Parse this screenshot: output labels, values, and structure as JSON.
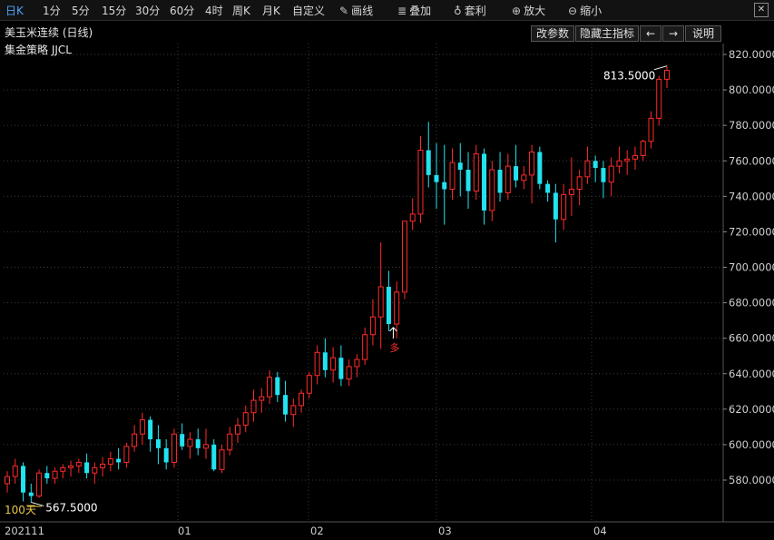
{
  "toolbar": {
    "periods": [
      "日K",
      "1分",
      "5分",
      "15分",
      "30分",
      "60分",
      "4时",
      "周K",
      "月K",
      "自定义"
    ],
    "active_period": "日K",
    "tools": [
      {
        "icon": "pencil-icon",
        "label": "画线"
      },
      {
        "icon": "stack-icon",
        "label": "叠加"
      },
      {
        "icon": "moneybag-icon",
        "label": "套利"
      },
      {
        "icon": "zoom-in-icon",
        "label": "放大"
      },
      {
        "icon": "zoom-out-icon",
        "label": "缩小"
      }
    ]
  },
  "chart_title": "美玉米连续 (日线)",
  "strategy_label": "集金策略 JJCL",
  "panel_buttons": {
    "params": "改参数",
    "hide_indicator": "隐藏主指标",
    "prev": "←",
    "next": "→",
    "help": "说明"
  },
  "annotations": {
    "high_price": "813.5000",
    "low_price": "567.5000",
    "days_label": "100天",
    "signal_label": "多"
  },
  "colors": {
    "up": "#ff2b2b",
    "down": "#22e3f0",
    "grid": "#3a3a3a",
    "background": "#000000",
    "signal": "#ff3030"
  },
  "chart_data": {
    "type": "candlestick",
    "title": "美玉米连续 (日线)",
    "y_ticks": [
      "820.0000",
      "800.0000",
      "780.0000",
      "760.0000",
      "740.0000",
      "720.0000",
      "700.0000",
      "680.0000",
      "660.0000",
      "640.0000",
      "620.0000",
      "600.0000",
      "580.0000"
    ],
    "ylim": [
      560,
      826
    ],
    "x_ticks": [
      "202111",
      "01",
      "02",
      "03",
      "04"
    ],
    "grid": true,
    "ohlc": [
      [
        578,
        585,
        573,
        582
      ],
      [
        582,
        592,
        578,
        588
      ],
      [
        588,
        590,
        568,
        573
      ],
      [
        573,
        578,
        567.5,
        571
      ],
      [
        571,
        586,
        570,
        584
      ],
      [
        584,
        588,
        578,
        581
      ],
      [
        581,
        587,
        578,
        585
      ],
      [
        585,
        589,
        581,
        587
      ],
      [
        587,
        591,
        582,
        588
      ],
      [
        588,
        592,
        584,
        590
      ],
      [
        590,
        595,
        581,
        584
      ],
      [
        584,
        590,
        578,
        587
      ],
      [
        587,
        593,
        582,
        589
      ],
      [
        589,
        596,
        585,
        592
      ],
      [
        592,
        598,
        586,
        590
      ],
      [
        590,
        601,
        587,
        599
      ],
      [
        599,
        611,
        596,
        606
      ],
      [
        606,
        618,
        600,
        614
      ],
      [
        614,
        616,
        596,
        603
      ],
      [
        603,
        611,
        589,
        598
      ],
      [
        598,
        603,
        586,
        590
      ],
      [
        590,
        609,
        587,
        606
      ],
      [
        606,
        612,
        597,
        599
      ],
      [
        599,
        607,
        592,
        603
      ],
      [
        603,
        609,
        594,
        598
      ],
      [
        598,
        609,
        592,
        600
      ],
      [
        600,
        603,
        585,
        586
      ],
      [
        586,
        600,
        584,
        597
      ],
      [
        597,
        610,
        594,
        606
      ],
      [
        606,
        615,
        601,
        611
      ],
      [
        611,
        622,
        607,
        618
      ],
      [
        618,
        631,
        613,
        625
      ],
      [
        625,
        632,
        618,
        627
      ],
      [
        627,
        642,
        623,
        638
      ],
      [
        638,
        641,
        624,
        628
      ],
      [
        628,
        636,
        613,
        617
      ],
      [
        617,
        626,
        610,
        622
      ],
      [
        622,
        631,
        618,
        629
      ],
      [
        629,
        641,
        626,
        639
      ],
      [
        639,
        656,
        634,
        652
      ],
      [
        652,
        660,
        638,
        642
      ],
      [
        642,
        655,
        635,
        649
      ],
      [
        649,
        656,
        633,
        637
      ],
      [
        637,
        648,
        633,
        644
      ],
      [
        644,
        651,
        638,
        648
      ],
      [
        648,
        666,
        645,
        662
      ],
      [
        662,
        682,
        656,
        672
      ],
      [
        672,
        714,
        654,
        689
      ],
      [
        689,
        698,
        664,
        668
      ],
      [
        668,
        692,
        660,
        686
      ],
      [
        686,
        726,
        682,
        726
      ],
      [
        726,
        739,
        721,
        730
      ],
      [
        730,
        774,
        725,
        766
      ],
      [
        766,
        782,
        745,
        752
      ],
      [
        752,
        770,
        733,
        748
      ],
      [
        748,
        769,
        724,
        744
      ],
      [
        744,
        767,
        738,
        759
      ],
      [
        759,
        770,
        740,
        755
      ],
      [
        755,
        765,
        733,
        743
      ],
      [
        743,
        769,
        738,
        764
      ],
      [
        764,
        767,
        724,
        732
      ],
      [
        732,
        760,
        726,
        755
      ],
      [
        755,
        765,
        737,
        742
      ],
      [
        742,
        764,
        738,
        757
      ],
      [
        757,
        769,
        745,
        749
      ],
      [
        749,
        757,
        744,
        752
      ],
      [
        752,
        769,
        736,
        765
      ],
      [
        765,
        768,
        744,
        747
      ],
      [
        747,
        749,
        737,
        742
      ],
      [
        742,
        747,
        714,
        727
      ],
      [
        727,
        747,
        721,
        741
      ],
      [
        741,
        762,
        729,
        744
      ],
      [
        744,
        755,
        735,
        751
      ],
      [
        751,
        768,
        747,
        760
      ],
      [
        760,
        763,
        748,
        756
      ],
      [
        756,
        760,
        739,
        748
      ],
      [
        748,
        762,
        740,
        757
      ],
      [
        757,
        768,
        753,
        760
      ],
      [
        760,
        766,
        752,
        761
      ],
      [
        761,
        768,
        755,
        763
      ],
      [
        763,
        772,
        760,
        771
      ],
      [
        771,
        788,
        767,
        784
      ],
      [
        784,
        808,
        780,
        806
      ],
      [
        806,
        813.5,
        801,
        811
      ]
    ]
  }
}
